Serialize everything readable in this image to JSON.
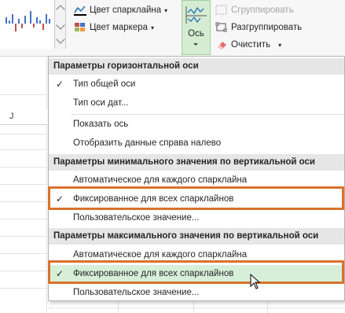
{
  "ribbon": {
    "sparkline_color_label": "Цвет спарклайна",
    "marker_color_label": "Цвет маркера",
    "axis_label": "Ось",
    "group_label": "Сгруппировать",
    "ungroup_label": "Разгруппировать",
    "clear_label": "Очистить",
    "colors": {
      "axis_highlight": "#d5ecd3",
      "sparkline": "#2e75b6"
    }
  },
  "sheet": {
    "column_letter": "J"
  },
  "menu": {
    "sections": [
      {
        "header": "Параметры горизонтальной оси",
        "items": [
          {
            "label": "Тип общей оси",
            "checked": true
          },
          {
            "label": "Тип оси дат...",
            "checked": false
          }
        ]
      },
      {
        "header": null,
        "items": [
          {
            "label": "Показать ось",
            "checked": false
          },
          {
            "label": "Отобразить данные справа налево",
            "checked": false
          }
        ]
      },
      {
        "header": "Параметры минимального значения по вертикальной оси",
        "items": [
          {
            "label": "Автоматическое для каждого спарклайна",
            "checked": false
          },
          {
            "label": "Фиксированное для всех спарклайнов",
            "checked": true
          },
          {
            "label": "Пользовательское значение...",
            "checked": false
          }
        ]
      },
      {
        "header": "Параметры максимального значения по вертикальной оси",
        "items": [
          {
            "label": "Автоматическое для каждого спарклайна",
            "checked": false
          },
          {
            "label": "Фиксированное для всех спарклайнов",
            "checked": true,
            "hovered": true
          },
          {
            "label": "Пользовательское значение...",
            "checked": false
          }
        ]
      }
    ],
    "check_glyph": "✓",
    "colors": {
      "annotation_outline": "#d9722b",
      "hover_fill": "#d7efd9",
      "header_fill": "#e6e6e6"
    }
  }
}
